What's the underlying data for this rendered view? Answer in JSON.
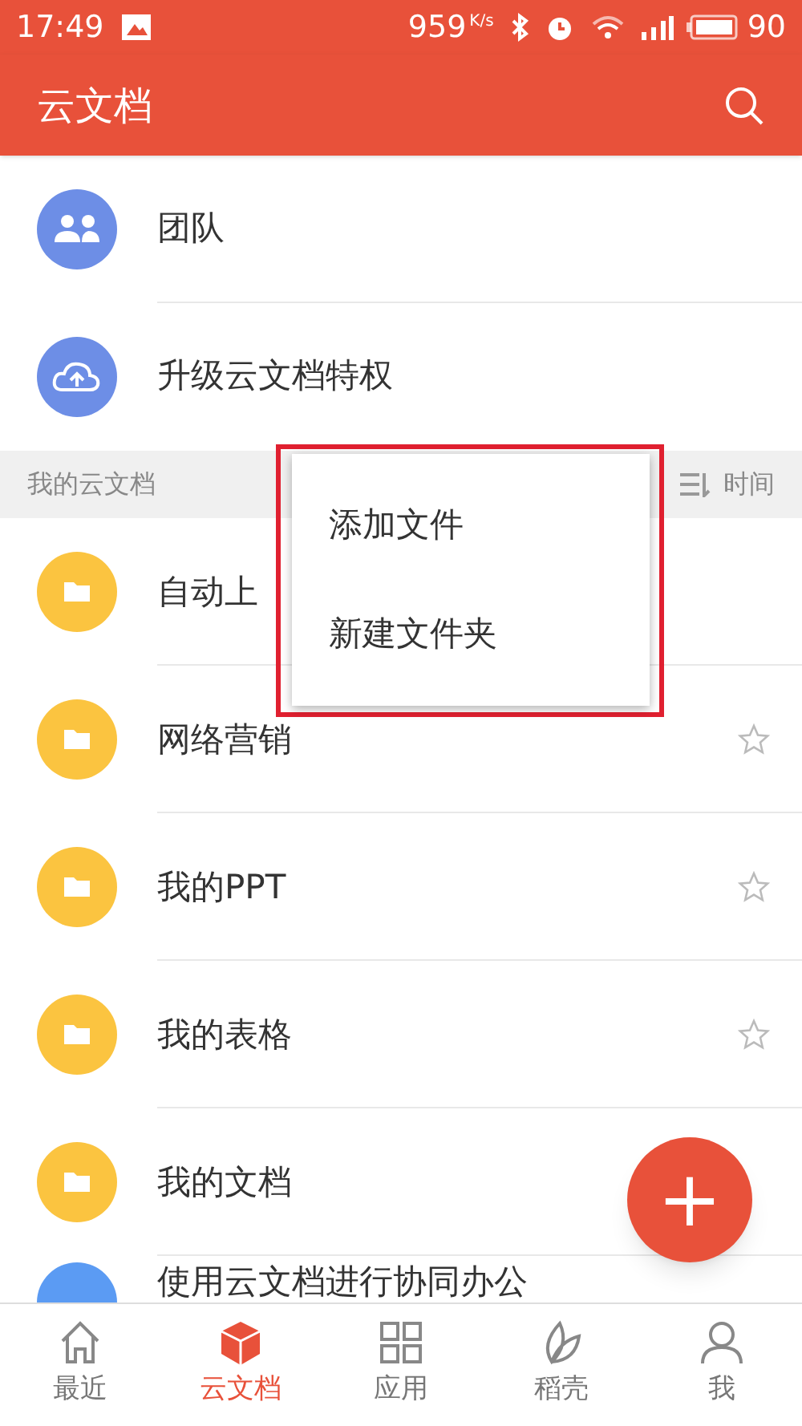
{
  "status_bar": {
    "time": "17:49",
    "speed": "959",
    "speed_unit": "K/s",
    "battery": "90"
  },
  "app_bar": {
    "title": "云文档"
  },
  "top_items": [
    {
      "label": "团队",
      "kind": "team"
    },
    {
      "label": "升级云文档特权",
      "kind": "upgrade"
    }
  ],
  "section": {
    "title": "我的云文档",
    "sort": "时间"
  },
  "files": [
    {
      "name": "自动上"
    },
    {
      "name": "网络营销",
      "starred": false
    },
    {
      "name": "我的PPT",
      "starred": false
    },
    {
      "name": "我的表格",
      "starred": false
    },
    {
      "name": "我的文档"
    },
    {
      "name": "使用云文档进行协同办公",
      "kind": "doc"
    }
  ],
  "menu": {
    "items": [
      "添加文件",
      "新建文件夹"
    ]
  },
  "fab": {
    "label": "+"
  },
  "bottom_nav": [
    {
      "label": "最近",
      "kind": "home",
      "selected": false
    },
    {
      "label": "云文档",
      "kind": "cube",
      "selected": true
    },
    {
      "label": "应用",
      "kind": "grid",
      "selected": false
    },
    {
      "label": "稻壳",
      "kind": "leaf",
      "selected": false
    },
    {
      "label": "我",
      "kind": "person",
      "selected": false
    }
  ]
}
